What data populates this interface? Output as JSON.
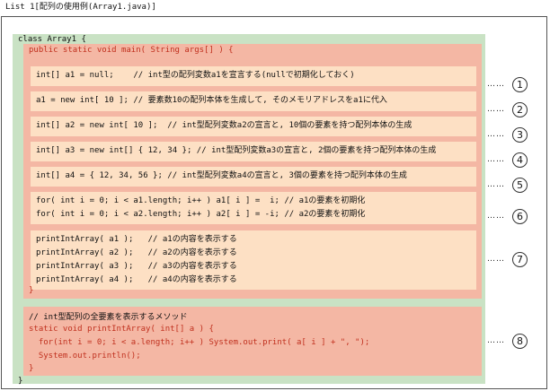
{
  "title": "List 1[配列の使用例(Array1.java)]",
  "class_header": "class Array1 {",
  "class_close": "}",
  "method_header": "public static void main( String args[] ) {",
  "method_close": "}",
  "statements": [
    {
      "lines": [
        "int[] a1 = null;    // int型の配列変数a1を宣言する(nullで初期化しておく)"
      ]
    },
    {
      "lines": [
        "a1 = new int[ 10 ]; // 要素数10の配列本体を生成して, そのメモリアドレスをa1に代入"
      ]
    },
    {
      "lines": [
        "int[] a2 = new int[ 10 ];  // int型配列変数a2の宣言と, 10個の要素を持つ配列本体の生成"
      ]
    },
    {
      "lines": [
        "int[] a3 = new int[] { 12, 34 }; // int型配列変数a3の宣言と, 2個の要素を持つ配列本体の生成"
      ]
    },
    {
      "lines": [
        "int[] a4 = { 12, 34, 56 }; // int型配列変数a4の宣言と, 3個の要素を持つ配列本体の生成"
      ]
    },
    {
      "lines": [
        "for( int i = 0; i < a1.length; i++ ) a1[ i ] =  i; // a1の要素を初期化",
        "for( int i = 0; i < a2.length; i++ ) a2[ i ] = -i; // a2の要素を初期化"
      ]
    },
    {
      "lines": [
        "printIntArray( a1 );   // a1の内容を表示する",
        "printIntArray( a2 );   // a2の内容を表示する",
        "printIntArray( a3 );   // a3の内容を表示する",
        "printIntArray( a4 );   // a4の内容を表示する"
      ]
    }
  ],
  "helper": {
    "comment": "// int型配列の全要素を表示するメソッド",
    "header": "static void printIntArray( int[] a ) {",
    "body": [
      "  for(int i = 0; i < a.length; i++ ) System.out.print( a[ i ] + \", \");",
      "  System.out.println();"
    ],
    "close": "}"
  },
  "annotations": [
    {
      "dots": "……",
      "number": "1"
    },
    {
      "dots": "……",
      "number": "2"
    },
    {
      "dots": "……",
      "number": "3"
    },
    {
      "dots": "……",
      "number": "4"
    },
    {
      "dots": "……",
      "number": "5"
    },
    {
      "dots": "……",
      "number": "6"
    },
    {
      "dots": "……",
      "number": "7"
    },
    {
      "dots": "……",
      "number": "8"
    }
  ]
}
